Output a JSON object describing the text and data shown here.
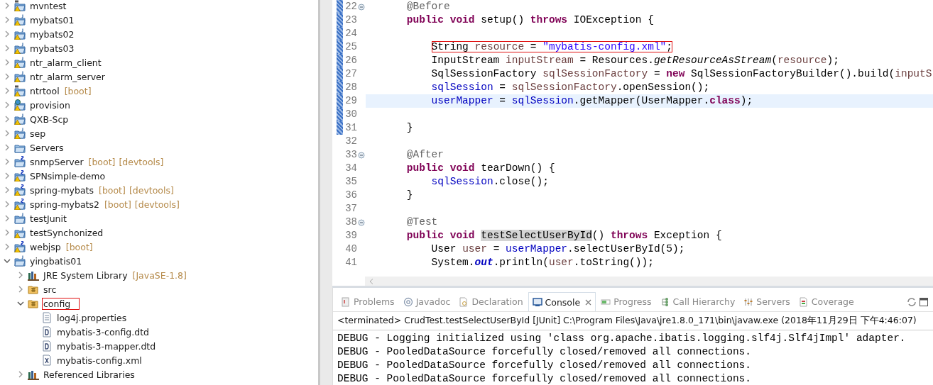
{
  "project_explorer": {
    "items": [
      {
        "label": "mvntest",
        "kind": "maven",
        "warning": true,
        "expanded": false
      },
      {
        "label": "mybats01",
        "kind": "project",
        "warning": true,
        "expanded": false
      },
      {
        "label": "mybats02",
        "kind": "project",
        "warning": true,
        "expanded": false
      },
      {
        "label": "mybats03",
        "kind": "project",
        "warning": true,
        "expanded": false
      },
      {
        "label": "ntr_alarm_client",
        "kind": "project",
        "warning": true,
        "expanded": false
      },
      {
        "label": "ntr_alarm_server",
        "kind": "project",
        "warning": true,
        "expanded": false
      },
      {
        "label": "ntrtool",
        "decorations": [
          "[boot]"
        ],
        "kind": "maven",
        "warning": true,
        "expanded": false
      },
      {
        "label": "provision",
        "kind": "web",
        "warning": true,
        "expanded": false
      },
      {
        "label": "QXB-Scp",
        "kind": "project",
        "warning": true,
        "expanded": false
      },
      {
        "label": "sep",
        "kind": "project",
        "warning": true,
        "expanded": false
      },
      {
        "label": "Servers",
        "kind": "folder",
        "warning": false,
        "expanded": false
      },
      {
        "label": "snmpServer",
        "decorations": [
          "[boot]",
          "[devtools]"
        ],
        "kind": "spring",
        "warning": false,
        "expanded": false
      },
      {
        "label": "SPNsimple-demo",
        "kind": "spring",
        "warning": true,
        "expanded": false
      },
      {
        "label": "spring-mybats",
        "decorations": [
          "[boot]",
          "[devtools]"
        ],
        "kind": "spring",
        "warning": true,
        "expanded": false
      },
      {
        "label": "spring-mybats2",
        "decorations": [
          "[boot]",
          "[devtools]"
        ],
        "kind": "spring",
        "warning": true,
        "expanded": false
      },
      {
        "label": "testJunit",
        "kind": "project",
        "warning": false,
        "expanded": false
      },
      {
        "label": "testSynchonized",
        "kind": "project",
        "warning": true,
        "expanded": false
      },
      {
        "label": "webjsp",
        "decorations": [
          "[boot]"
        ],
        "kind": "spring",
        "warning": true,
        "expanded": false
      },
      {
        "label": "yingbatis01",
        "kind": "project",
        "warning": false,
        "expanded": true,
        "children": [
          {
            "label": "JRE System Library",
            "decorations": [
              "[JavaSE-1.8]"
            ],
            "kind": "library",
            "expanded": false
          },
          {
            "label": "src",
            "kind": "package-folder",
            "expanded": false
          },
          {
            "label": "config",
            "kind": "package-folder",
            "expanded": true,
            "outlined": true,
            "children": [
              {
                "label": "log4j.properties",
                "kind": "text-file"
              },
              {
                "label": "mybatis-3-config.dtd",
                "kind": "dtd-file"
              },
              {
                "label": "mybatis-3-mapper.dtd",
                "kind": "dtd-file"
              },
              {
                "label": "mybatis-config.xml",
                "kind": "xml-file"
              }
            ]
          },
          {
            "label": "Referenced Libraries",
            "kind": "library",
            "expanded": false
          }
        ]
      }
    ]
  },
  "editor": {
    "lines": [
      {
        "number": "22",
        "fold": true,
        "changed": true,
        "current": false,
        "kind": "member",
        "segments": [
          {
            "text": "@Before",
            "kind": "annotation"
          }
        ]
      },
      {
        "number": "23",
        "fold": false,
        "changed": true,
        "current": false,
        "kind": "member",
        "segments": [
          {
            "text": "public void",
            "kind": "keyword"
          },
          {
            "text": " setup() ",
            "kind": "plain"
          },
          {
            "text": "throws",
            "kind": "keyword"
          },
          {
            "text": " IOException {",
            "kind": "plain"
          }
        ]
      },
      {
        "number": "24",
        "fold": false,
        "changed": true,
        "current": false
      },
      {
        "number": "25",
        "fold": false,
        "changed": true,
        "current": false,
        "outlined": true,
        "kind": "statement",
        "segments": [
          {
            "text": "String ",
            "kind": "plain"
          },
          {
            "text": "resource",
            "kind": "local"
          },
          {
            "text": " = ",
            "kind": "plain"
          },
          {
            "text": "\"mybatis-config.xml\"",
            "kind": "string"
          },
          {
            "text": ";",
            "kind": "plain"
          }
        ]
      },
      {
        "number": "26",
        "fold": false,
        "changed": true,
        "current": false,
        "kind": "statement",
        "segments": [
          {
            "text": "InputStream ",
            "kind": "plain"
          },
          {
            "text": "inputStream",
            "kind": "local"
          },
          {
            "text": " = Resources.",
            "kind": "plain"
          },
          {
            "text": "getResourceAsStream",
            "kind": "static-method"
          },
          {
            "text": "(",
            "kind": "plain"
          },
          {
            "text": "resource",
            "kind": "local"
          },
          {
            "text": ");",
            "kind": "plain"
          }
        ]
      },
      {
        "number": "27",
        "fold": false,
        "changed": true,
        "current": false,
        "kind": "statement",
        "segments": [
          {
            "text": "SqlSessionFactory ",
            "kind": "plain"
          },
          {
            "text": "sqlSessionFactory",
            "kind": "local"
          },
          {
            "text": " = ",
            "kind": "plain"
          },
          {
            "text": "new",
            "kind": "keyword"
          },
          {
            "text": " SqlSessionFactoryBuilder().build(",
            "kind": "plain"
          },
          {
            "text": "inputS",
            "kind": "local"
          }
        ]
      },
      {
        "number": "28",
        "fold": false,
        "changed": true,
        "current": false,
        "kind": "statement",
        "segments": [
          {
            "text": "sqlSession",
            "kind": "field"
          },
          {
            "text": " = ",
            "kind": "plain"
          },
          {
            "text": "sqlSessionFactory",
            "kind": "local"
          },
          {
            "text": ".openSession();",
            "kind": "plain"
          }
        ]
      },
      {
        "number": "29",
        "fold": false,
        "changed": true,
        "current": true,
        "kind": "statement",
        "segments": [
          {
            "text": "userMapper",
            "kind": "field"
          },
          {
            "text": " = ",
            "kind": "plain"
          },
          {
            "text": "sqlSession",
            "kind": "field"
          },
          {
            "text": ".getMapper(UserMapper.",
            "kind": "plain"
          },
          {
            "text": "class",
            "kind": "keyword"
          },
          {
            "text": ");",
            "kind": "plain"
          }
        ]
      },
      {
        "number": "30",
        "fold": false,
        "changed": true,
        "current": false
      },
      {
        "number": "31",
        "fold": false,
        "changed": true,
        "current": false,
        "kind": "member",
        "segments": [
          {
            "text": "}",
            "kind": "plain"
          }
        ]
      },
      {
        "number": "32",
        "fold": false,
        "changed": false,
        "current": false
      },
      {
        "number": "33",
        "fold": true,
        "changed": false,
        "current": false,
        "kind": "member",
        "segments": [
          {
            "text": "@After",
            "kind": "annotation"
          }
        ]
      },
      {
        "number": "34",
        "fold": false,
        "changed": false,
        "current": false,
        "kind": "member",
        "segments": [
          {
            "text": "public void",
            "kind": "keyword"
          },
          {
            "text": " tearDown() {",
            "kind": "plain"
          }
        ]
      },
      {
        "number": "35",
        "fold": false,
        "changed": false,
        "current": false,
        "kind": "statement",
        "segments": [
          {
            "text": "sqlSession",
            "kind": "field"
          },
          {
            "text": ".close();",
            "kind": "plain"
          }
        ]
      },
      {
        "number": "36",
        "fold": false,
        "changed": false,
        "current": false,
        "kind": "member",
        "segments": [
          {
            "text": "}",
            "kind": "plain"
          }
        ]
      },
      {
        "number": "37",
        "fold": false,
        "changed": false,
        "current": false
      },
      {
        "number": "38",
        "fold": true,
        "changed": false,
        "current": false,
        "kind": "member",
        "segments": [
          {
            "text": "@Test",
            "kind": "annotation"
          }
        ]
      },
      {
        "number": "39",
        "fold": false,
        "changed": false,
        "current": false,
        "kind": "member",
        "segments": [
          {
            "text": "public void ",
            "kind": "keyword"
          },
          {
            "text": "testSelectUserById",
            "kind": "occurrence"
          },
          {
            "text": "() ",
            "kind": "plain"
          },
          {
            "text": "throws",
            "kind": "keyword"
          },
          {
            "text": " Exception {",
            "kind": "plain"
          }
        ]
      },
      {
        "number": "40",
        "fold": false,
        "changed": false,
        "current": false,
        "kind": "statement",
        "segments": [
          {
            "text": "User ",
            "kind": "plain"
          },
          {
            "text": "user",
            "kind": "local"
          },
          {
            "text": " = ",
            "kind": "plain"
          },
          {
            "text": "userMapper",
            "kind": "field"
          },
          {
            "text": ".selectUserById(5);",
            "kind": "plain"
          }
        ]
      },
      {
        "number": "41",
        "fold": false,
        "changed": false,
        "current": false,
        "kind": "statement",
        "segments": [
          {
            "text": "System.",
            "kind": "plain"
          },
          {
            "text": "out",
            "kind": "static-field"
          },
          {
            "text": ".println(",
            "kind": "plain"
          },
          {
            "text": "user",
            "kind": "local"
          },
          {
            "text": ".toString());",
            "kind": "plain"
          }
        ]
      }
    ]
  },
  "console_view": {
    "tabs": [
      {
        "label": "Problems",
        "kind": "problems",
        "selected": false
      },
      {
        "label": "Javadoc",
        "kind": "javadoc",
        "selected": false
      },
      {
        "label": "Declaration",
        "kind": "declaration",
        "selected": false
      },
      {
        "label": "Console",
        "kind": "console",
        "selected": true
      },
      {
        "label": "Progress",
        "kind": "progress",
        "selected": false
      },
      {
        "label": "Call Hierarchy",
        "kind": "hierarchy",
        "selected": false
      },
      {
        "label": "Servers",
        "kind": "servers",
        "selected": false
      },
      {
        "label": "Coverage",
        "kind": "coverage",
        "selected": false
      }
    ],
    "status": "<terminated> CrudTest.testSelectUserById [JUnit] C:\\Program Files\\Java\\jre1.8.0_171\\bin\\javaw.exe (2018年11月29日 下午4:46:07)",
    "output": [
      "DEBUG - Logging initialized using 'class org.apache.ibatis.logging.slf4j.Slf4jImpl' adapter.",
      "DEBUG - PooledDataSource forcefully closed/removed all connections.",
      "DEBUG - PooledDataSource forcefully closed/removed all connections.",
      "DEBUG - PooledDataSource forcefully closed/removed all connections."
    ]
  }
}
